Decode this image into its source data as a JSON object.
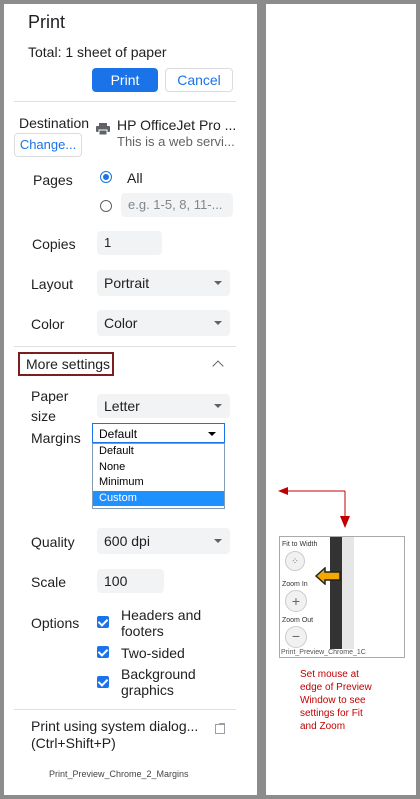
{
  "dialog": {
    "title": "Print",
    "total": "Total: 1 sheet of paper",
    "print_label": "Print",
    "cancel_label": "Cancel"
  },
  "destination": {
    "label": "Destination",
    "change_label": "Change...",
    "printer_name": "HP OfficeJet Pro ...",
    "printer_desc": "This is a web servi..."
  },
  "pages": {
    "label": "Pages",
    "all_label": "All",
    "custom_placeholder": "e.g. 1-5, 8, 11-..."
  },
  "copies": {
    "label": "Copies",
    "value": "1"
  },
  "layout": {
    "label": "Layout",
    "value": "Portrait"
  },
  "color": {
    "label": "Color",
    "value": "Color"
  },
  "more_settings": {
    "label": "More settings"
  },
  "paper_size": {
    "label_line1": "Paper",
    "label_line2": "size",
    "value": "Letter"
  },
  "margins": {
    "label": "Margins",
    "value": "Default",
    "options": [
      "Default",
      "None",
      "Minimum",
      "Custom"
    ],
    "highlighted": "Custom"
  },
  "quality": {
    "label": "Quality",
    "value": "600 dpi"
  },
  "scale": {
    "label": "Scale",
    "value": "100"
  },
  "options": {
    "label": "Options",
    "headers_line1": "Headers and",
    "headers_line2": "footers",
    "two_sided": "Two-sided",
    "background_line1": "Background",
    "background_line2": "graphics"
  },
  "system_dialog": {
    "line1": "Print using system dialog...",
    "line2": "(Ctrl+Shift+P)"
  },
  "caption_left": "Print_Preview_Chrome_2_Margins",
  "inset": {
    "fit_to_width": "Fit to Width",
    "zoom_in": "Zoom In",
    "zoom_out": "Zoom Out",
    "caption": "Print_Preview_Chrome_1C"
  },
  "note": {
    "line1": "Set mouse at",
    "line2": "edge of Preview",
    "line3": "Window to see",
    "line4": "settings for Fit",
    "line5": "and Zoom"
  },
  "colors": {
    "accent": "#1a73e8",
    "highlight": "#1e90ff",
    "annotation": "#c00000",
    "box_border": "#7b1e1e"
  }
}
